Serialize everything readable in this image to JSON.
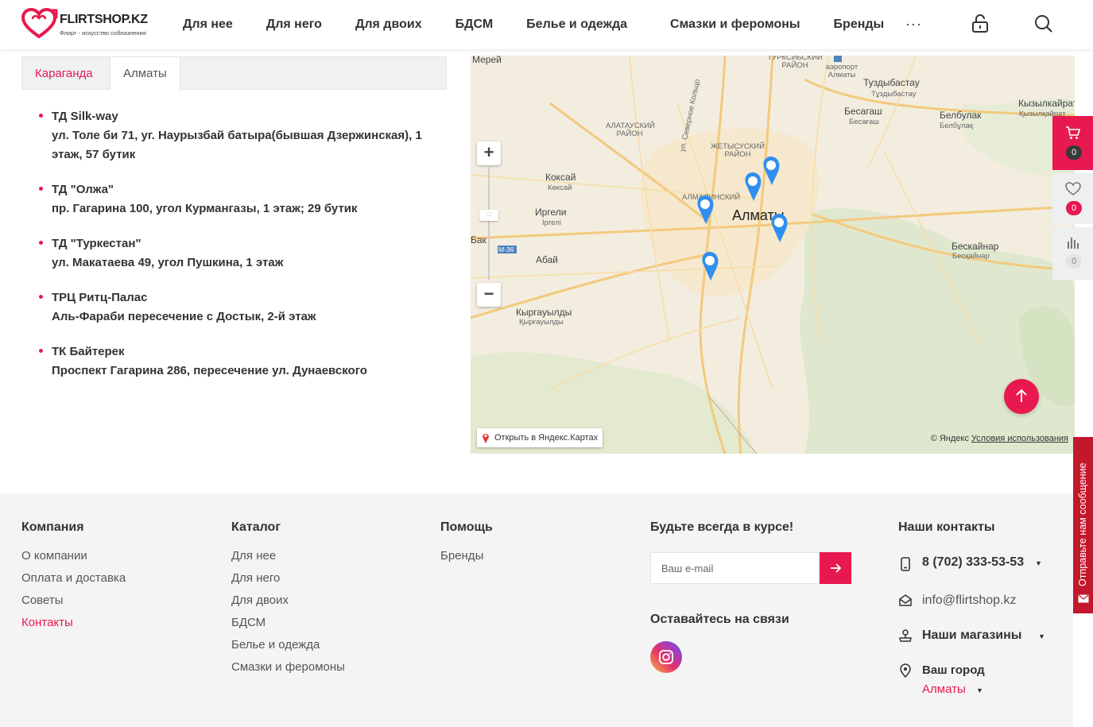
{
  "header": {
    "logo_text": "FLIRTSHOP.KZ",
    "logo_tagline": "Флирт - искусство соблазнения",
    "nav": [
      "Для нее",
      "Для него",
      "Для двоих",
      "БДСМ",
      "Белье и одежда",
      "Смазки и феромоны",
      "Бренды"
    ],
    "more": "···"
  },
  "tabs": [
    "Караганда",
    "Алматы"
  ],
  "active_tab": "Алматы",
  "stores": [
    {
      "name": "ТД Silk-way",
      "address": "ул. Толе би 71, уг. Наурызбай батыра(бывшая Дзержинская), 1 этаж, 57 бутик"
    },
    {
      "name": "ТД \"Олжа\"",
      "address": "пр. Гагарина 100, угол Курмангазы, 1 этаж; 29 бутик"
    },
    {
      "name": "ТД \"Туркестан\"",
      "address": "ул. Макатаева 49, угол Пушкина, 1 этаж"
    },
    {
      "name": "ТРЦ Ритц-Палас",
      "address": "Аль-Фараби пересечение с Достык, 2-й этаж"
    },
    {
      "name": "ТК Байтерек",
      "address": "Проспект Гагарина 286, пересечение ул. Дунаевского"
    }
  ],
  "map": {
    "open_link": "Открыть в Яндекс.Картах",
    "copyright": "© Яндекс",
    "terms": "Условия использования",
    "zoom_in": "+",
    "zoom_out": "−",
    "city_label": "Алматы",
    "labels": {
      "mereke": "Мерей",
      "turksib": "ТУРКСИБСКИЙ РАЙОН",
      "airport": "аэропорт Алматы",
      "tuzdybastau": "Туздыбастау",
      "tuzdybastau2": "Тұздыбастау",
      "besagash": "Бесагаш",
      "besagash2": "Бесағаш",
      "belbulak": "Белбулак",
      "belbulak2": "Белбұлақ",
      "kyzylkairat": "Кызылкайрат",
      "kyzylkairat2": "Қызылқайрат",
      "alatau": "АЛАТАУСКИЙ РАЙОН",
      "zhetysu": "ЖЕТЫСУСКИЙ РАЙОН",
      "almalinsky": "АЛМАЛИНСКИЙ",
      "severnoe": "ул. Северное Кольцо",
      "koksay": "Коксай",
      "koksay2": "Көксай",
      "irgeli": "Иргели",
      "irgeli2": "Іргелі",
      "bak": "Бак",
      "m36": "M-36",
      "abay": "Абай",
      "beskainar": "Бескайнар",
      "beskainar2": "Бесқайнар",
      "kyrgauldy": "Кыргауылды",
      "kyrgauldy2": "Қырғауылды"
    }
  },
  "side": {
    "cart_count": "0",
    "fav_count": "0",
    "compare_count": "0",
    "feedback": "Отправьте нам сообщение"
  },
  "footer": {
    "company": {
      "title": "Компания",
      "links": [
        "О компании",
        "Оплата и доставка",
        "Советы",
        "Контакты"
      ]
    },
    "catalog": {
      "title": "Каталог",
      "links": [
        "Для нее",
        "Для него",
        "Для двоих",
        "БДСМ",
        "Белье и одежда",
        "Смазки и феромоны"
      ]
    },
    "help": {
      "title": "Помощь",
      "links": [
        "Бренды"
      ]
    },
    "subscribe": {
      "title": "Будьте всегда в курсе!",
      "placeholder": "Ваш e-mail",
      "social_title": "Оставайтесь на связи"
    },
    "contacts": {
      "title": "Наши контакты",
      "phone": "8 (702) 333-53-53",
      "email": "info@flirtshop.kz",
      "stores": "Наши магазины",
      "city_label": "Ваш город",
      "city": "Алматы"
    }
  },
  "colors": {
    "accent": "#e8194f",
    "feedback": "#c3172c",
    "pin": "#2f8ff0"
  }
}
